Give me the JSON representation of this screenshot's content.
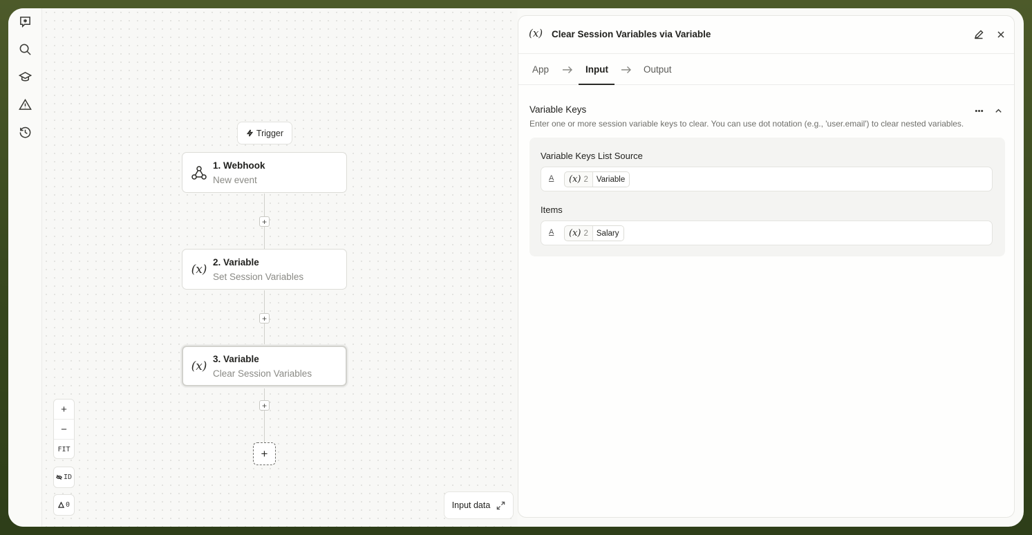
{
  "rail": {
    "items": [
      {
        "name": "workspace-logo-icon"
      },
      {
        "name": "search-icon"
      },
      {
        "name": "learn-cap-icon"
      },
      {
        "name": "warning-icon"
      },
      {
        "name": "history-icon"
      }
    ]
  },
  "canvas": {
    "trigger_label": "Trigger",
    "nodes": [
      {
        "title": "1. Webhook",
        "subtitle": "New event",
        "icon": "webhook-icon"
      },
      {
        "title": "2. Variable",
        "subtitle": "Set Session Variables",
        "icon": "variable-icon"
      },
      {
        "title": "3. Variable",
        "subtitle": "Clear Session Variables",
        "icon": "variable-icon"
      }
    ],
    "variable_glyph": "(x)",
    "add_glyph": "+",
    "zoom_in": "+",
    "zoom_out": "−",
    "fit_label": "FIT",
    "id_toggle_label": "ID",
    "warning_count": "0",
    "input_data_label": "Input data"
  },
  "panel": {
    "icon_glyph": "(x)",
    "title": "Clear Session Variables via Variable",
    "tabs": [
      {
        "label": "App"
      },
      {
        "label": "Input"
      },
      {
        "label": "Output"
      }
    ],
    "active_tab": "Input",
    "section": {
      "title": "Variable Keys",
      "description": "Enter one or more session variable keys to clear. You can use dot notation (e.g., 'user.email') to clear nested variables."
    },
    "fields": [
      {
        "label": "Variable Keys List Source",
        "type_glyph": "A",
        "pill_glyph": "(x)",
        "pill_step": "2",
        "pill_text": "Variable"
      },
      {
        "label": "Items",
        "type_glyph": "A",
        "pill_glyph": "(x)",
        "pill_step": "2",
        "pill_text": "Salary"
      }
    ]
  }
}
